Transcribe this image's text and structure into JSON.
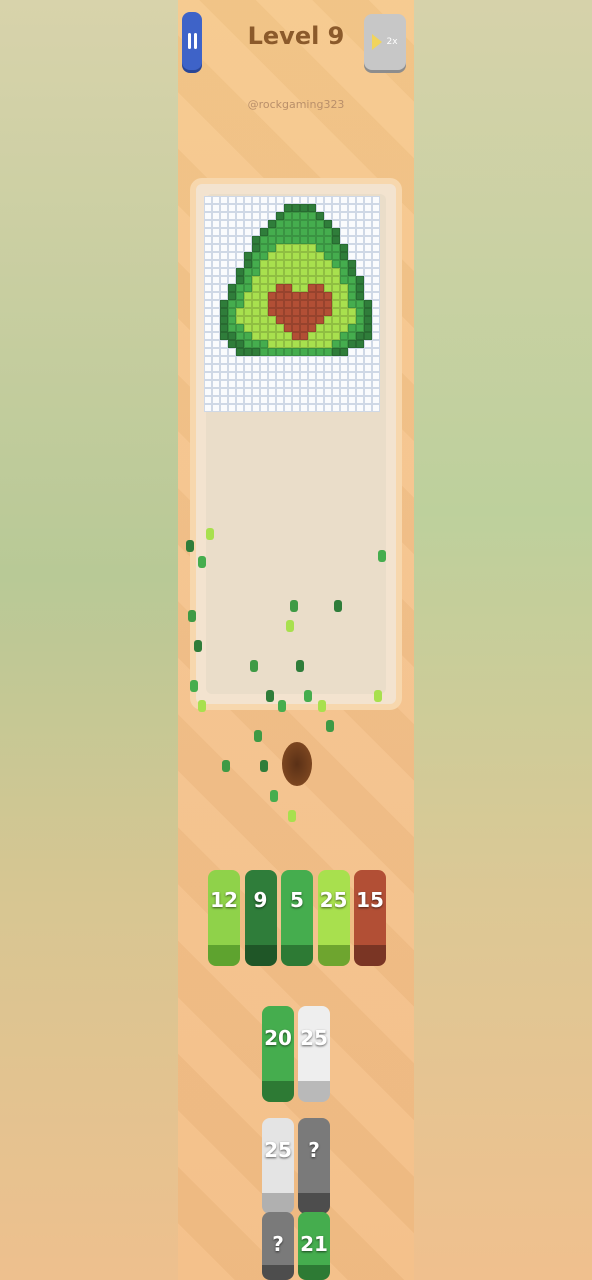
{
  "header": {
    "level": "Level 9",
    "handle": "@rockgaming323",
    "speed": "2x"
  },
  "icons": {
    "pause": "pause-icon",
    "skip": "fast-forward-icon"
  },
  "colors": {
    "dark_green": "#2f7d3a",
    "green": "#45ad4e",
    "light_green": "#a8e04e",
    "brown": "#b24f35",
    "white": "#f5f5f5",
    "grey": "#7a7a7a"
  },
  "pixel_art": {
    "rows": [
      "0000000000000000000000",
      "0000000000DDDD00000000",
      "000000000DGGGGD0000000",
      "00000000DGGGGGGD000000",
      "0000000DGGGGGGGGD00000",
      "000000DGGGGGGGGGD00000",
      "000000DGGLLLLLGGGD0000",
      "00000DGGLLLLLLLGGD0000",
      "00000DGLLLLLLLLLGGD000",
      "0000DGGLLLLLLLLLLGD000",
      "0000DGLLLLLLLLLLLGGD00",
      "000DGGLLLBBLLBBLLLGD00",
      "000DGLLLBBBBBBBBLLGD00",
      "00DGGLLLBBBBBBBBLLGGD0",
      "00DGLLLLBBBBBBBBLLLGD0",
      "00DGLLLLLBBBBBBLLLLGD0",
      "00DGGLLLLLBBBBLLLLGGD0",
      "00DDGGLLLLLBBLLLLGGDD0",
      "000DDGGGLLLLLLLLGGDD00",
      "0000DDDGGGGGGGGGDD0000"
    ]
  },
  "stacks": [
    {
      "value": "12",
      "color": "#8fd24a",
      "shade": "#5ea32f"
    },
    {
      "value": "9",
      "color": "#2f7d3a",
      "shade": "#1f5627"
    },
    {
      "value": "5",
      "color": "#45ad4e",
      "shade": "#2d7a34"
    },
    {
      "value": "25",
      "color": "#a8e04e",
      "shade": "#6ea52f"
    },
    {
      "value": "15",
      "color": "#b24f35",
      "shade": "#7a3524"
    }
  ],
  "queue": [
    {
      "value": "20",
      "color": "#45ad4e",
      "shade": "#2d7a34"
    },
    {
      "value": "25",
      "color": "#eeeeee",
      "shade": "#b9b9b9"
    },
    {
      "value": "25",
      "color": "#e4e4e4",
      "shade": "#b0b0b0"
    },
    {
      "value": "?",
      "color": "#7a7a7a",
      "shade": "#4d4d4d"
    },
    {
      "value": "?",
      "color": "#7a7a7a",
      "shade": "#4d4d4d"
    },
    {
      "value": "21",
      "color": "#45ad4e",
      "shade": "#2d7a34"
    }
  ]
}
